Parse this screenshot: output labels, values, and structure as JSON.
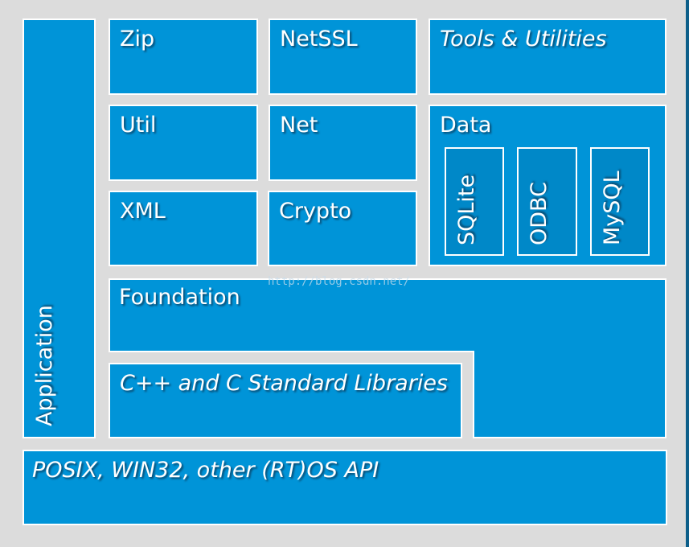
{
  "diagram": {
    "application": "Application",
    "zip": "Zip",
    "netssl": "NetSSL",
    "tools": "Tools & Utilities",
    "util": "Util",
    "net": "Net",
    "data": "Data",
    "xml": "XML",
    "crypto": "Crypto",
    "connectors": [
      "SQLite",
      "ODBC",
      "MySQL"
    ],
    "foundation": "Foundation",
    "stdlib": "C++ and C Standard Libraries",
    "os_api": "POSIX, WIN32, other (RT)OS API"
  },
  "watermark": "http://blog.csdn.net/",
  "colors": {
    "box": "#0094d8",
    "background": "#dcdcdc",
    "border": "#ffffff"
  }
}
